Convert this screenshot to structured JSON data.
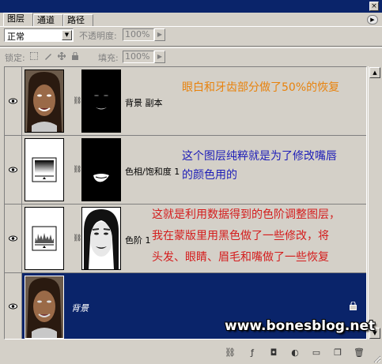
{
  "tabs": [
    {
      "label": "图层",
      "active": true
    },
    {
      "label": "通道",
      "active": false
    },
    {
      "label": "路径",
      "active": false
    }
  ],
  "options": {
    "blend_mode": "正常",
    "opacity_label": "不透明度:",
    "opacity_value": "100%",
    "lock_label": "锁定:",
    "fill_label": "填充:",
    "fill_value": "100%"
  },
  "layers": [
    {
      "name": "背景 副本",
      "annotation": [
        "眼白和牙齿部分做了50%的恢复"
      ],
      "annotation_color": "#e8820c",
      "thumb_icon": "face-photo",
      "mask_icon": "mask-eyes-teeth",
      "selected": false
    },
    {
      "name": "色相/饱和度 1",
      "annotation": [
        "这个图层纯粹就是为了修改嘴唇",
        "的颜色用的"
      ],
      "annotation_color": "#1d1db8",
      "thumb_icon": "hue-saturation-adjustment-icon",
      "mask_icon": "mask-lips",
      "selected": false
    },
    {
      "name": "色阶 1",
      "annotation": [
        "这就是利用数据得到的色阶调整图层，",
        "我在蒙版里用黑色做了一些修改，将",
        "头发、眼睛、眉毛和嘴做了一些恢复"
      ],
      "annotation_color": "#d41c1c",
      "thumb_icon": "levels-adjustment-icon",
      "mask_icon": "mask-face",
      "selected": false
    },
    {
      "name": "背景",
      "annotation": [],
      "annotation_color": "#ffffff",
      "thumb_icon": "face-photo",
      "mask_icon": "",
      "selected": true
    }
  ],
  "watermark": "www.bonesblog.net",
  "colors": {
    "panel": "#d4d0c8",
    "title": "#0a246a",
    "selection": "#0a246a"
  },
  "bottom_icons": [
    "link-layers-icon",
    "layer-style-icon",
    "add-mask-icon",
    "adjustment-layer-icon",
    "new-group-icon",
    "new-layer-icon",
    "delete-layer-icon"
  ]
}
